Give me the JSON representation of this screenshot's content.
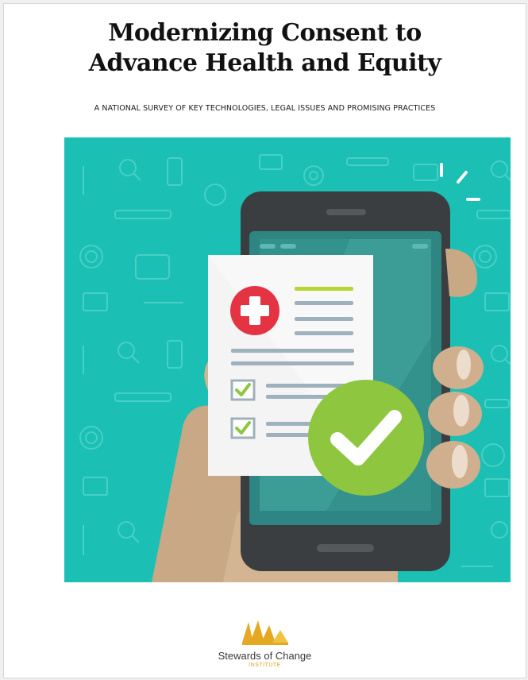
{
  "document": {
    "title_line1": "Modernizing Consent to",
    "title_line2": "Advance Health and Equity",
    "subtitle": "A NATIONAL SURVEY OF KEY TECHNOLOGIES, LEGAL ISSUES AND PROMISING PRACTICES"
  },
  "illustration": {
    "subject": "hand holding smartphone with medical consent form and check mark",
    "colors": {
      "background": "#1bbfb4",
      "phone": "#3a3d40",
      "screen": "#2c7d7a",
      "paper": "#f3f3f3",
      "red_cross": "#e63545",
      "green_check": "#8ec63f",
      "hand": "#cfaf8e"
    }
  },
  "organization": {
    "name": "Stewards of Change",
    "sub": "INSTITUTE",
    "logo_color": "#e5a823"
  }
}
